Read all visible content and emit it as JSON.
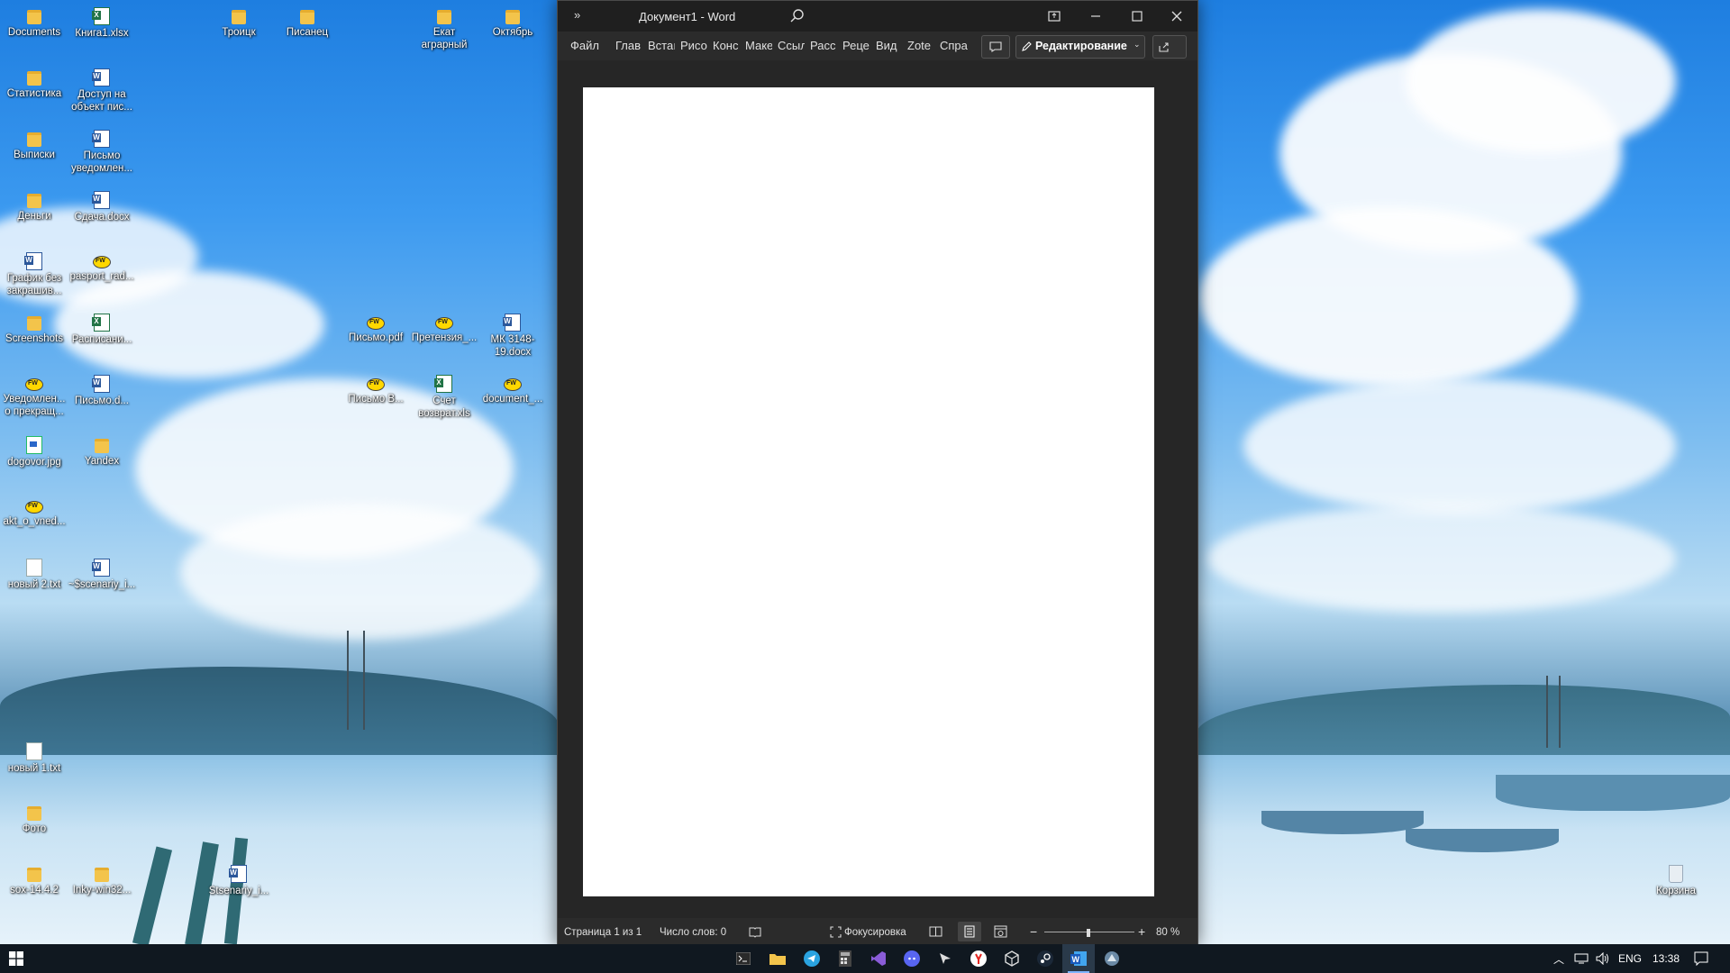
{
  "desktop": {
    "icons": [
      {
        "label": "Documents",
        "type": "folder"
      },
      {
        "label": "Книга1.xlsx",
        "type": "excel"
      },
      {
        "label": "Троицк",
        "type": "folder"
      },
      {
        "label": "Писанец",
        "type": "folder"
      },
      {
        "label": "Екат аграрный",
        "type": "folder"
      },
      {
        "label": "Октябрь",
        "type": "folder"
      },
      {
        "label": "Статистика",
        "type": "folder"
      },
      {
        "label": "Доступ на объект пис...",
        "type": "word"
      },
      {
        "label": "Выписки",
        "type": "folder"
      },
      {
        "label": "Письмо уведомлен...",
        "type": "word"
      },
      {
        "label": "Деньги",
        "type": "folder"
      },
      {
        "label": "Сдача.docx",
        "type": "word"
      },
      {
        "label": "График без закрашив...",
        "type": "word"
      },
      {
        "label": "pasport_rad...",
        "type": "pdf"
      },
      {
        "label": "Screenshots",
        "type": "folder"
      },
      {
        "label": "Расписани...",
        "type": "excel"
      },
      {
        "label": "Письмо.pdf",
        "type": "pdf"
      },
      {
        "label": "Претензия_...",
        "type": "pdf"
      },
      {
        "label": "МК 3148-19.docx",
        "type": "word"
      },
      {
        "label": "Уведомлен... о прекращ...",
        "type": "pdf"
      },
      {
        "label": "Письмо.d...",
        "type": "word"
      },
      {
        "label": "Письмо В...",
        "type": "pdf"
      },
      {
        "label": "Счет возврат.xls",
        "type": "excel"
      },
      {
        "label": "document_...",
        "type": "pdf"
      },
      {
        "label": "dogovor.jpg",
        "type": "image"
      },
      {
        "label": "Yandex",
        "type": "folder"
      },
      {
        "label": "akt_o_vned...",
        "type": "pdf"
      },
      {
        "label": "новый 2.txt",
        "type": "txt"
      },
      {
        "label": "~$scenariy_i...",
        "type": "word"
      },
      {
        "label": "новый 1.txt",
        "type": "txt"
      },
      {
        "label": "Фото",
        "type": "folder"
      },
      {
        "label": "sox-14.4.2",
        "type": "folder"
      },
      {
        "label": "Inky-win32...",
        "type": "folder"
      },
      {
        "label": "Stsenariy_i...",
        "type": "word"
      },
      {
        "label": "Корзина",
        "type": "recycle"
      }
    ]
  },
  "word": {
    "title": "Документ1  -  Word",
    "quick_access": "»",
    "tabs": [
      "Файл",
      "Глав",
      "Встаı",
      "Рисо",
      "Конс",
      "Маке",
      "Ссыл",
      "Расс",
      "Реце",
      "Вид",
      "Zote",
      "Спра"
    ],
    "editing_label": "Редактирование",
    "status": {
      "page": "Страница 1 из 1",
      "words": "Число слов: 0",
      "focus": "Фокусировка",
      "zoom": "80 %",
      "zoom_level": 0.45
    }
  },
  "taskbar": {
    "lang": "ENG",
    "time": "13:38",
    "apps": [
      "terminal",
      "explorer",
      "telegram",
      "calculator",
      "visual-studio",
      "discord",
      "cursor-app",
      "yandex-browser",
      "unity",
      "steam",
      "word",
      "another-app"
    ]
  },
  "colors": {
    "word_blue": "#2b579a",
    "excel_green": "#217346",
    "taskbar": "#101820"
  }
}
